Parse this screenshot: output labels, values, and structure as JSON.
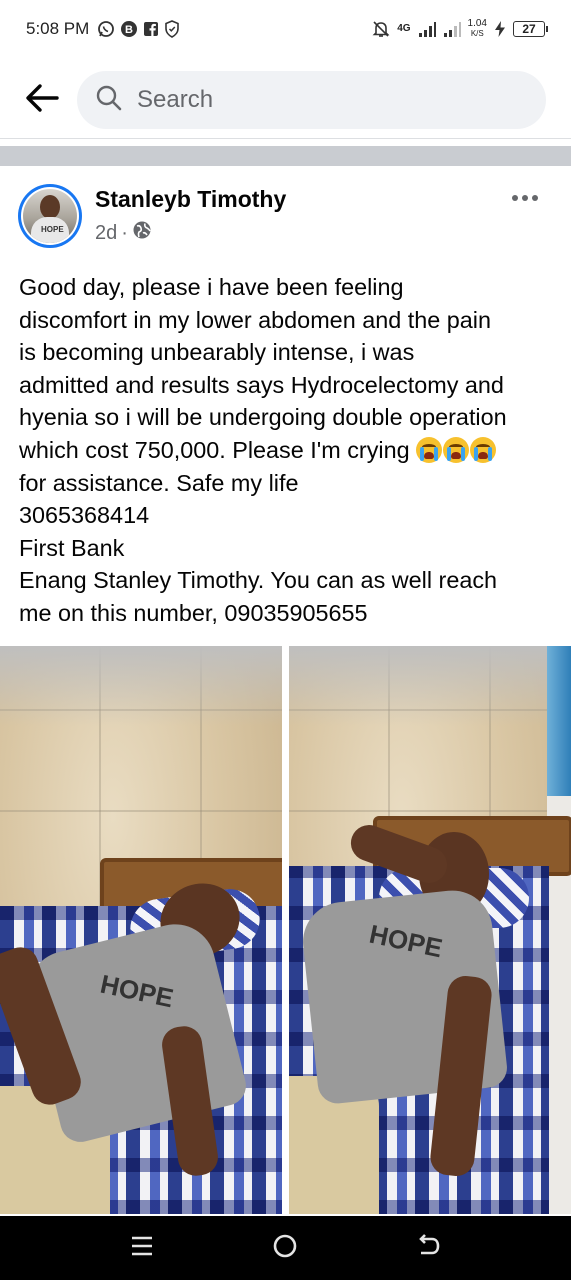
{
  "status_bar": {
    "time": "5:08 PM",
    "network": "4G",
    "speed_value": "1.04",
    "speed_unit": "K/S",
    "battery": "27",
    "icons_left": [
      "whatsapp-icon",
      "b-icon",
      "facebook-icon",
      "shield-icon"
    ],
    "icons_right": [
      "mute-bell-icon",
      "signal-icon",
      "signal-icon",
      "charging-icon",
      "battery-icon"
    ]
  },
  "header": {
    "back_icon": "back-arrow-icon",
    "search_placeholder": "Search",
    "search_icon": "search-icon"
  },
  "post": {
    "author": "Stanleyb Timothy",
    "avatar_tag": "HOPE",
    "time_ago": "2d",
    "separator": "·",
    "privacy_icon": "globe-icon",
    "more_icon": "more-dots-icon",
    "text_lines": [
      "Good day, please i have been feeling",
      "discomfort in my lower abdomen and the pain",
      "is becoming unbearably intense, i was",
      "admitted and results says Hydrocelectomy and",
      "hyenia so i will be undergoing double operation",
      "which cost 750,000. Please I'm crying ",
      "for assistance. Safe my life",
      "3065368414",
      "First Bank",
      "Enang Stanley Timothy.    You can as well reach",
      "me on this number,  09035905655"
    ],
    "emoji_icon": "loudly-crying-face-emoji",
    "emoji_count": 3,
    "photos": [
      {
        "name": "photo-1",
        "shirt_text": "HOPE"
      },
      {
        "name": "photo-2",
        "shirt_text": "HOPE"
      }
    ]
  },
  "nav_bar": {
    "buttons": [
      "recent-apps-icon",
      "home-icon",
      "back-icon"
    ]
  }
}
